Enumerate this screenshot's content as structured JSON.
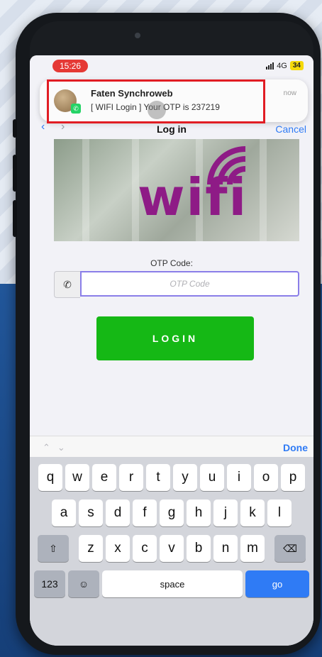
{
  "status_bar": {
    "time": "15:26",
    "network": "4G",
    "battery": "34"
  },
  "notification": {
    "title": "Faten Synchroweb",
    "body": "[ WIFI Login ] Your OTP is 237219",
    "time": "now",
    "app_icon": "whatsapp-icon"
  },
  "nav": {
    "title": "Log in",
    "cancel": "Cancel",
    "back_icon": "chevron-left-icon",
    "forward_icon": "chevron-right-icon"
  },
  "banner": {
    "brand_text": "wifi",
    "brand_color": "#8e1b86"
  },
  "otp": {
    "label": "OTP Code:",
    "placeholder": "OTP Code",
    "value": "",
    "addon_icon": "phone-icon"
  },
  "login_button": {
    "label": "LOGIN",
    "color": "#15b815"
  },
  "keyboard": {
    "done": "Done",
    "row1": [
      "q",
      "w",
      "e",
      "r",
      "t",
      "y",
      "u",
      "i",
      "o",
      "p"
    ],
    "row2": [
      "a",
      "s",
      "d",
      "f",
      "g",
      "h",
      "j",
      "k",
      "l"
    ],
    "row3": [
      "z",
      "x",
      "c",
      "v",
      "b",
      "n",
      "m"
    ],
    "numbers_key": "123",
    "space_key": "space",
    "go_key": "go",
    "accent": "#2f7bf5"
  }
}
